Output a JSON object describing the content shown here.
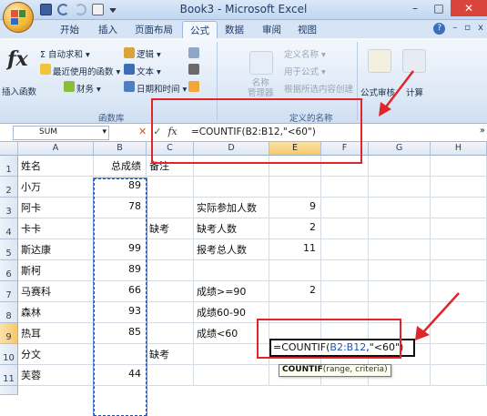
{
  "window": {
    "title": "Book3 - Microsoft Excel",
    "minimize": "–",
    "maximize": "□",
    "close": "✕"
  },
  "ribbon_tabs": [
    "开始",
    "插入",
    "页面布局",
    "公式",
    "数据",
    "审阅",
    "视图"
  ],
  "ribbon_tab_controls": [
    "?",
    "–",
    "▫",
    "x"
  ],
  "ribbon": {
    "insert_function_label": "插入函数",
    "autosum": "Σ 自动求和 ▾",
    "recent_used": "最近使用的函数 ▾",
    "financial": "财务 ▾",
    "logical": "逻辑 ▾",
    "text": "文本 ▾",
    "date_time": "日期和时间 ▾",
    "library_label": "函数库",
    "name_manager": "名称\n管理器",
    "define_name": "定义名称 ▾",
    "use_in_formula": "用于公式 ▾",
    "create_from_selection": "根据所选内容创建",
    "defined_names_label": "定义的名称",
    "formula_audit": "公式审核",
    "calculate": "计算"
  },
  "formula_bar": {
    "name_box": "SUM",
    "formula": "=COUNTIF(B2:B12,\"<60\")"
  },
  "columns": [
    "A",
    "B",
    "C",
    "D",
    "E",
    "F",
    "G",
    "H"
  ],
  "rows": [
    {
      "n": "1",
      "A": "姓名",
      "B": "总成绩",
      "C": "备注",
      "D": "",
      "E": ""
    },
    {
      "n": "2",
      "A": "小万",
      "B": "89",
      "C": "",
      "D": "",
      "E": ""
    },
    {
      "n": "3",
      "A": "阿卡",
      "B": "78",
      "C": "",
      "D": "实际参加人数",
      "E": "9"
    },
    {
      "n": "4",
      "A": "卡卡",
      "B": "",
      "C": "缺考",
      "D": "缺考人数",
      "E": "2"
    },
    {
      "n": "5",
      "A": "斯达康",
      "B": "99",
      "C": "",
      "D": "报考总人数",
      "E": "11"
    },
    {
      "n": "6",
      "A": "斯柯",
      "B": "89",
      "C": "",
      "D": "",
      "E": ""
    },
    {
      "n": "7",
      "A": "马赛科",
      "B": "66",
      "C": "",
      "D": "成绩>=90",
      "E": "2"
    },
    {
      "n": "8",
      "A": "森林",
      "B": "93",
      "C": "",
      "D": "成绩60-90",
      "E": ""
    },
    {
      "n": "9",
      "A": "热耳",
      "B": "85",
      "C": "",
      "D": "成绩<60",
      "E": ""
    },
    {
      "n": "10",
      "A": "分文",
      "B": "",
      "C": "缺考",
      "D": "",
      "E": ""
    },
    {
      "n": "11",
      "A": "芙蓉",
      "B": "44",
      "C": "",
      "D": "",
      "E": ""
    }
  ],
  "editing_cell": {
    "prefix": "=COUNTIF(",
    "ref": "B2:B12",
    "suffix": ",\"<60\")"
  },
  "tooltip": {
    "func": "COUNTIF",
    "args": "(range, criteria)"
  },
  "colors": {
    "annotation_red": "#e0262a",
    "selection_blue": "#1f50b0",
    "header_highlight": "#f5c86a"
  }
}
